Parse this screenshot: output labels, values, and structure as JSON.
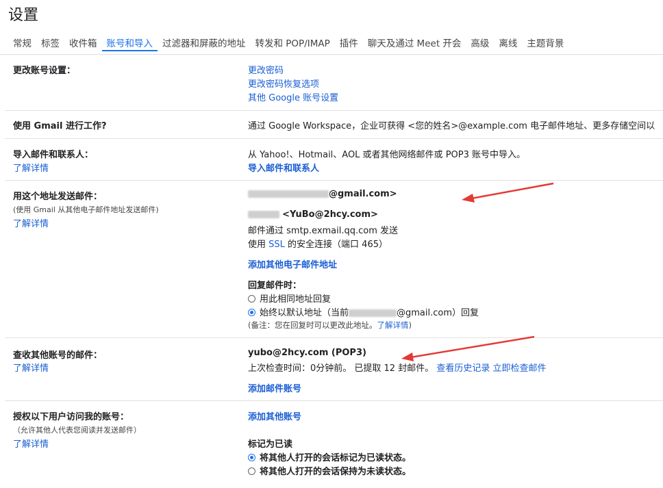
{
  "page_title": "设置",
  "tabs": [
    {
      "label": "常规",
      "active": false
    },
    {
      "label": "标签",
      "active": false
    },
    {
      "label": "收件箱",
      "active": false
    },
    {
      "label": "账号和导入",
      "active": true
    },
    {
      "label": "过滤器和屏蔽的地址",
      "active": false
    },
    {
      "label": "转发和 POP/IMAP",
      "active": false
    },
    {
      "label": "插件",
      "active": false
    },
    {
      "label": "聊天及通过 Meet 开会",
      "active": false
    },
    {
      "label": "高级",
      "active": false
    },
    {
      "label": "离线",
      "active": false
    },
    {
      "label": "主题背景",
      "active": false
    }
  ],
  "change_account": {
    "label": "更改账号设置：",
    "links": [
      "更改密码",
      "更改密码恢复选项",
      "其他 Google 账号设置"
    ]
  },
  "workspace": {
    "label": "使用 Gmail 进行工作?",
    "text": "通过 Google Workspace，企业可获得 <您的姓名>@example.com 电子邮件地址、更多存储空间以"
  },
  "import": {
    "label": "导入邮件和联系人：",
    "learn_more": "了解详情",
    "text": "从 Yahoo!、Hotmail、AOL 或者其他网络邮件或 POP3 账号中导入。",
    "action": "导入邮件和联系人"
  },
  "send_as": {
    "label": "用这个地址发送邮件：",
    "sub": "(使用 Gmail 从其他电子邮件地址发送邮件)",
    "learn_more": "了解详情",
    "address1": "@gmail.com>",
    "address2": "<YuBo@2hcy.com>",
    "smtp_text": "邮件通过 smtp.exmail.qq.com 发送",
    "ssl_prefix": "使用",
    "ssl_link": "SSL",
    "ssl_suffix": "的安全连接（端口 465）",
    "add_address": "添加其他电子邮件地址",
    "reply_heading": "回复邮件时：",
    "reply_option1": "用此相同地址回复",
    "reply_option2_prefix": "始终以默认地址（当前",
    "reply_option2_suffix": "@gmail.com）回复",
    "note": "(备注：您在回复时可以更改此地址。",
    "note_link": "了解详情",
    "note_end": ")"
  },
  "check_mail": {
    "label": "查收其他账号的邮件：",
    "learn_more": "了解详情",
    "account": "yubo@2hcy.com (POP3)",
    "last_check": "上次检查时间：0分钟前。 已提取 12 封邮件。",
    "history_link": "查看历史记录",
    "check_now_link": "立即检查邮件",
    "add_account": "添加邮件账号"
  },
  "grant_access": {
    "label": "授权以下用户访问我的账号：",
    "sub": "（允许其他人代表您阅读并发送邮件）",
    "learn_more": "了解详情",
    "add_other": "添加其他账号",
    "mark_read_heading": "标记为已读",
    "option1": "将其他人打开的会话标记为已读状态。",
    "option2": "将其他人打开的会话保持为未读状态。"
  },
  "colors": {
    "accent": "#1a73e8",
    "link": "#1a5ed4",
    "arrow": "#e53935"
  }
}
